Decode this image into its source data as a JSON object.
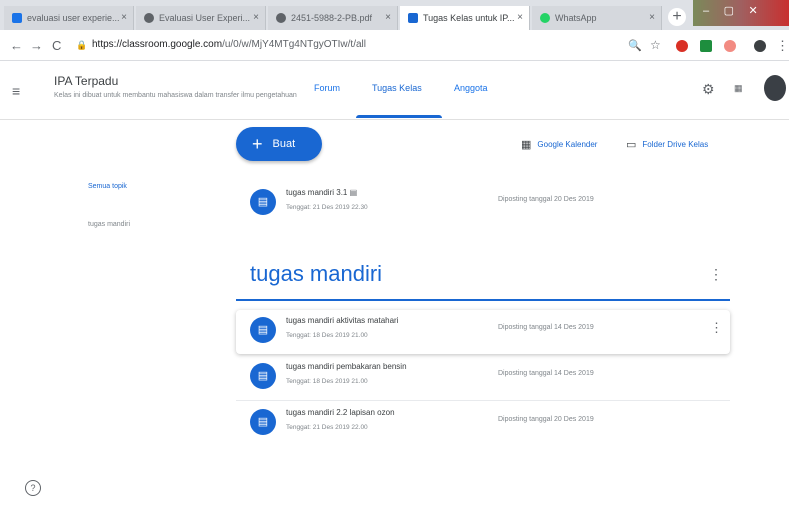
{
  "browser": {
    "tabs": [
      {
        "label": "evaluasi user experie...",
        "color": "#1a73e8"
      },
      {
        "label": "Evaluasi User Experi...",
        "color": "#5f6368"
      },
      {
        "label": "2451-5988-2-PB.pdf",
        "color": "#5f6368"
      },
      {
        "label": "Tugas Kelas untuk IP...",
        "color": "#1967d2"
      },
      {
        "label": "WhatsApp",
        "color": "#25d366"
      }
    ],
    "close_glyph": "×",
    "new_tab_glyph": "+",
    "url_host": "https://classroom.google.com",
    "url_path": "/u/0/w/MjY4MTg4NTgyOTIw/t/all",
    "back_glyph": "←",
    "forward_glyph": "→",
    "reload_glyph": "C"
  },
  "header": {
    "class_name": "IPA Terpadu",
    "class_desc": "Kelas ini dibuat untuk membantu mahasiswa dalam transfer ilmu pengetahuan",
    "tabs": [
      "Forum",
      "Tugas Kelas",
      "Anggota"
    ],
    "selected_tab": "Tugas Kelas"
  },
  "actions": {
    "create_label": "Buat",
    "calendar_label": "Google Kalender",
    "drive_label": "Folder Drive Kelas"
  },
  "sidebar": {
    "topics": [
      "Semua topik",
      "tugas mandiri"
    ]
  },
  "ungrouped": [
    {
      "title": "tugas mandiri 3.1",
      "due": "Tenggat: 21 Des 2019 22.30",
      "posted": "Diposting tanggal 20 Des 2019"
    }
  ],
  "topic": {
    "name": "tugas mandiri",
    "assignments": [
      {
        "title": "tugas mandiri aktivitas matahari",
        "due": "Tenggat: 18 Des 2019 21.00",
        "posted": "Diposting tanggal 14 Des 2019"
      },
      {
        "title": "tugas mandiri pembakaran bensin",
        "due": "Tenggat: 18 Des 2019 21.00",
        "posted": "Diposting tanggal 14 Des 2019"
      },
      {
        "title": "tugas mandiri 2.2 lapisan ozon",
        "due": "Tenggat: 21 Des 2019 22.00",
        "posted": "Diposting tanggal 20 Des 2019"
      }
    ]
  },
  "icons": {
    "menu": "≡",
    "more": "⋮",
    "settings": "⚙",
    "apps": "⋮⋮⋮",
    "help": "?",
    "assignment": "▤",
    "calendar": "▦",
    "folder": "▭"
  }
}
